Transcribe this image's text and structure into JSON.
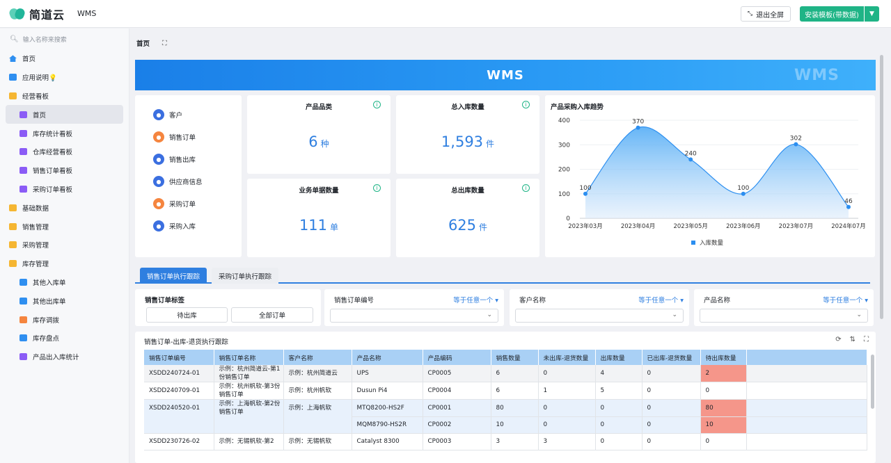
{
  "header": {
    "logo": "简道云",
    "app_name": "WMS",
    "exit_fullscreen": "退出全屏",
    "install": "安装模板(带数据)"
  },
  "sidebar": {
    "search_placeholder": "输入名称来搜索",
    "items": [
      {
        "label": "首页",
        "level": 1,
        "icon": "home-icon"
      },
      {
        "label": "应用说明💡",
        "level": 1,
        "icon": "doc-icon"
      },
      {
        "label": "经营看板",
        "level": 1,
        "icon": "folder-icon"
      },
      {
        "label": "首页",
        "level": 2,
        "icon": "dashboard-icon",
        "active": true
      },
      {
        "label": "库存统计看板",
        "level": 2,
        "icon": "dashboard-icon"
      },
      {
        "label": "仓库经营看板",
        "level": 2,
        "icon": "dashboard-icon"
      },
      {
        "label": "销售订单看板",
        "level": 2,
        "icon": "dashboard-icon"
      },
      {
        "label": "采购订单看板",
        "level": 2,
        "icon": "dashboard-icon"
      },
      {
        "label": "基础数据",
        "level": 1,
        "icon": "folder-icon"
      },
      {
        "label": "销售管理",
        "level": 1,
        "icon": "folder-icon"
      },
      {
        "label": "采购管理",
        "level": 1,
        "icon": "folder-icon"
      },
      {
        "label": "库存管理",
        "level": 1,
        "icon": "folder-icon"
      },
      {
        "label": "其他入库单",
        "level": 2,
        "icon": "doc-icon"
      },
      {
        "label": "其他出库单",
        "level": 2,
        "icon": "doc-icon"
      },
      {
        "label": "库存调拨",
        "level": 2,
        "icon": "transfer-icon"
      },
      {
        "label": "库存盘点",
        "level": 2,
        "icon": "doc-icon"
      },
      {
        "label": "产品出入库统计",
        "level": 2,
        "icon": "dashboard-icon"
      }
    ]
  },
  "breadcrumb": {
    "title": "首页"
  },
  "banner": {
    "title": "WMS",
    "ghost": "WMS"
  },
  "quick_links": [
    {
      "label": "客户",
      "color": "#3b6fe0"
    },
    {
      "label": "销售订单",
      "color": "#f5853f"
    },
    {
      "label": "销售出库",
      "color": "#3b6fe0"
    },
    {
      "label": "供应商信息",
      "color": "#3b6fe0"
    },
    {
      "label": "采购订单",
      "color": "#f5853f"
    },
    {
      "label": "采购入库",
      "color": "#3b6fe0"
    }
  ],
  "stats": [
    {
      "title": "产品品类",
      "value": "6",
      "unit": "种"
    },
    {
      "title": "总入库数量",
      "value": "1,593",
      "unit": "件"
    },
    {
      "title": "业务单据数量",
      "value": "111",
      "unit": "单"
    },
    {
      "title": "总出库数量",
      "value": "625",
      "unit": "件"
    }
  ],
  "chart_data": {
    "type": "area",
    "title": "产品采购入库趋势",
    "categories": [
      "2023年03月",
      "2023年04月",
      "2023年05月",
      "2023年06月",
      "2023年07月",
      "2024年07月"
    ],
    "series": [
      {
        "name": "入库数量",
        "values": [
          100,
          370,
          240,
          100,
          302,
          46
        ]
      }
    ],
    "ylim": [
      0,
      400
    ],
    "yticks": [
      0,
      100,
      200,
      300,
      400
    ],
    "legend": "bottom",
    "color": "#2b8ef0"
  },
  "tabs": [
    {
      "label": "销售订单执行跟踪",
      "active": true
    },
    {
      "label": "采购订单执行跟踪",
      "active": false
    }
  ],
  "filters": {
    "tag": {
      "label": "销售订单标签",
      "buttons": [
        "待出库",
        "全部订单"
      ]
    },
    "fields": [
      {
        "label": "销售订单编号",
        "mode": "等于任意一个 ▾"
      },
      {
        "label": "客户名称",
        "mode": "等于任意一个 ▾"
      },
      {
        "label": "产品名称",
        "mode": "等于任意一个 ▾"
      }
    ]
  },
  "table": {
    "title": "销售订单-出库-退货执行跟踪",
    "columns": [
      "销售订单编号",
      "销售订单名称",
      "客户名称",
      "产品名称",
      "产品编码",
      "销售数量",
      "未出库-退货数量",
      "出库数量",
      "已出库-退货数量",
      "待出库数量"
    ],
    "rows": [
      {
        "cells": [
          "XSDD240724-01",
          "示例：杭州简道云-第1份销售订单",
          "示例：杭州简道云",
          "UPS",
          "CP0005",
          "6",
          "0",
          "4",
          "0",
          "2"
        ]
      },
      {
        "cells": [
          "XSDD240709-01",
          "示例：杭州帆软-第3份销售订单",
          "示例：杭州帆软",
          "Dusun Pi4",
          "CP0004",
          "6",
          "1",
          "5",
          "0",
          "0"
        ]
      },
      {
        "cells": [
          "XSDD240520-01",
          "示例：上海帆软-第2份销售订单",
          "示例：上海帆软",
          "MTQ8200-HS2F",
          "CP0001",
          "80",
          "0",
          "0",
          "0",
          "80"
        ]
      },
      {
        "cells": [
          "",
          "",
          "",
          "MQM8790-HS2R",
          "CP0002",
          "10",
          "0",
          "0",
          "0",
          "10"
        ]
      },
      {
        "cells": [
          "XSDD230726-02",
          "示例：无锡帆软-第2",
          "示例：无锡帆软",
          "Catalyst 8300",
          "CP0003",
          "3",
          "3",
          "0",
          "0",
          "0"
        ]
      }
    ]
  }
}
